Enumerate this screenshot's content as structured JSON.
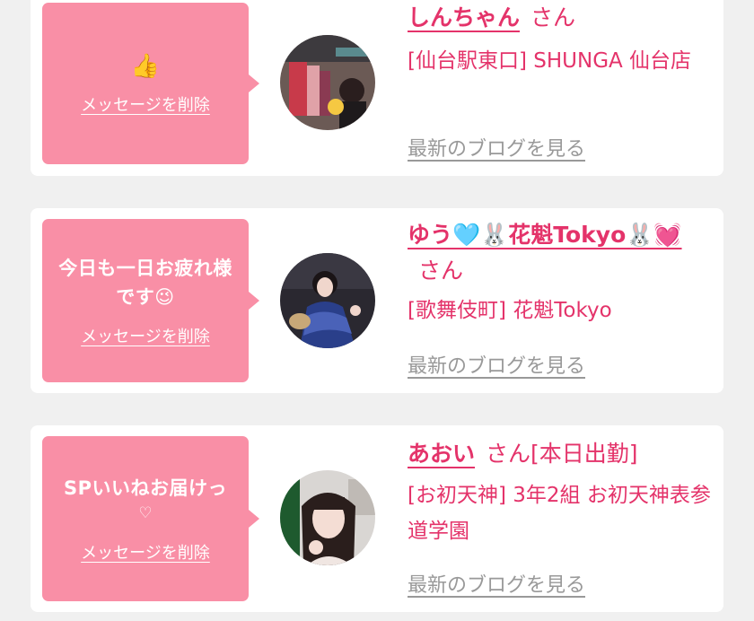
{
  "entries": [
    {
      "message_emoji": "👍",
      "message_text": "",
      "delete_label": "メッセージを削除",
      "name": "しんちゃん",
      "honorific": "さん",
      "status": "",
      "shop": "[仙台駅東口] SHUNGA 仙台店",
      "blog_label": "最新のブログを見る"
    },
    {
      "message_emoji": "",
      "message_text": "今日も一日お疲れ様です😉",
      "delete_label": "メッセージを削除",
      "name": "ゆう🩵🐰花魁Tokyo🐰💓",
      "honorific": "さん",
      "status": "",
      "shop": "[歌舞伎町] 花魁Tokyo",
      "blog_label": "最新のブログを見る"
    },
    {
      "message_emoji": "",
      "message_text": "SPいいねお届けっ",
      "message_sub": "♡",
      "delete_label": "メッセージを削除",
      "name": "あおい",
      "honorific": "さん",
      "status": "[本日出勤]",
      "shop": "[お初天神] 3年2組 お初天神表参道学園",
      "blog_label": "最新のブログを見る"
    }
  ],
  "colors": {
    "page_bg": "#f0f0f0",
    "card_bg": "#ffffff",
    "bubble_bg": "#f98fa6",
    "accent": "#e4336a",
    "muted": "#999999"
  }
}
